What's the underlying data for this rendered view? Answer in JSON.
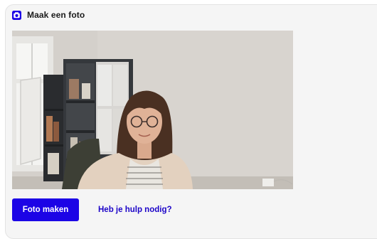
{
  "panel": {
    "title": "Maak een foto",
    "title_icon": "camera-icon",
    "accent_color": "#1c04e6"
  },
  "camera_preview": {
    "content": "live-webcam-feed"
  },
  "actions": {
    "take_photo_label": "Foto maken",
    "help_link_label": "Heb je hulp nodig?"
  }
}
